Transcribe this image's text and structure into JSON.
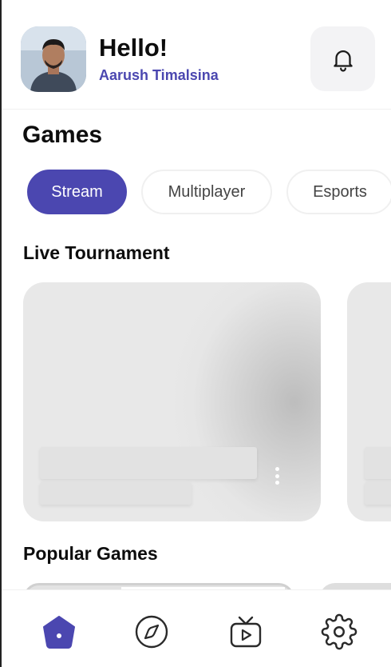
{
  "header": {
    "greeting": "Hello!",
    "username": "Aarush Timalsina",
    "avatar_icon": "user-avatar",
    "notification_icon": "bell-icon"
  },
  "games": {
    "title": "Games",
    "chips": [
      {
        "label": "Stream",
        "active": true
      },
      {
        "label": "Multiplayer",
        "active": false
      },
      {
        "label": "Esports",
        "active": false
      }
    ]
  },
  "live_tournament": {
    "title": "Live Tournament",
    "more_icon": "more-vertical-icon"
  },
  "popular_games": {
    "title": "Popular Games"
  },
  "bottom_nav": {
    "items": [
      {
        "icon": "home-icon",
        "active": true
      },
      {
        "icon": "compass-icon",
        "active": false
      },
      {
        "icon": "tv-icon",
        "active": false
      },
      {
        "icon": "settings-icon",
        "active": false
      }
    ]
  },
  "colors": {
    "accent": "#4b47b0",
    "text": "#0d0d0d",
    "icon": "#2a2a2a"
  }
}
